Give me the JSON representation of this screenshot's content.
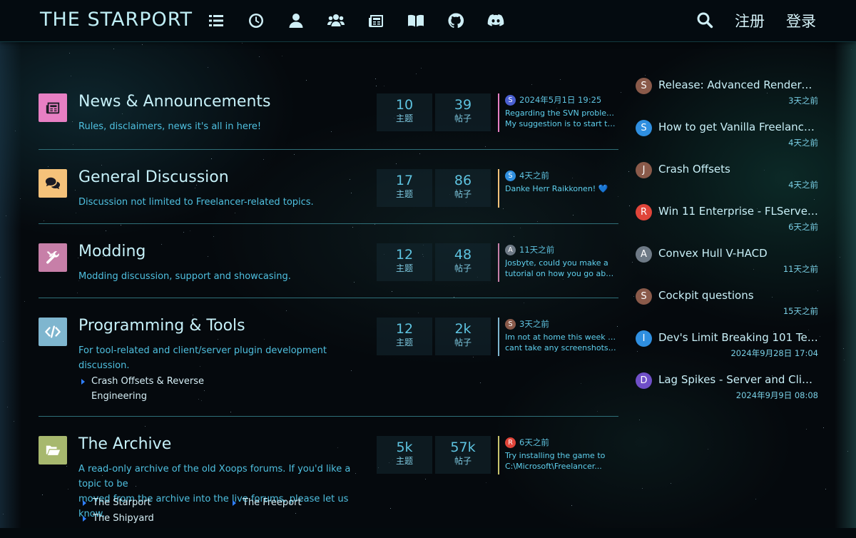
{
  "header": {
    "brand": "THE STARPORT",
    "nav_icons": [
      "list-icon",
      "clock-icon",
      "user-icon",
      "users-icon",
      "newspaper-icon",
      "book-icon",
      "github-icon",
      "discord-icon"
    ],
    "search_icon": "search-icon",
    "register_label": "注册",
    "login_label": "登录"
  },
  "forums": [
    {
      "title": "News & Announcements",
      "description": "Rules, disclaimers, news it's all in here!",
      "icon": "newspaper-icon",
      "icon_bg": "#e77fc3",
      "accent": "#e77fc3",
      "threads": "10",
      "threads_label": "主题",
      "posts": "39",
      "posts_label": "帖子",
      "last_avatar": "S",
      "last_avatar_color": "#4a5fd1",
      "last_time": "2024年5月1日 19:25",
      "last_excerpt_1": "Regarding the SVN problem:",
      "last_excerpt_2": "My suggestion is to start the..."
    },
    {
      "title": "General Discussion",
      "description": "Discussion not limited to Freelancer-related topics.",
      "icon": "comments-icon",
      "icon_bg": "#f5c27a",
      "accent": "#f5c27a",
      "threads": "17",
      "threads_label": "主题",
      "posts": "86",
      "posts_label": "帖子",
      "last_avatar": "S",
      "last_avatar_color": "#2f8fe0",
      "last_time": "4天之前",
      "last_excerpt_1": "Danke Herr Raikkonen! 💙",
      "last_excerpt_2": ""
    },
    {
      "title": "Modding",
      "description": "Modding discussion, support and showcasing.",
      "icon": "tools-icon",
      "icon_bg": "#c77fa8",
      "accent": "#c77fa8",
      "threads": "12",
      "threads_label": "主题",
      "posts": "48",
      "posts_label": "帖子",
      "last_avatar": "A",
      "last_avatar_color": "#6e7a86",
      "last_time": "11天之前",
      "last_excerpt_1": "Josbyte, could you make a",
      "last_excerpt_2": "tutorial on how you go about..."
    },
    {
      "title": "Programming & Tools",
      "description": "For tool-related and client/server plugin development discussion.",
      "icon": "code-icon",
      "icon_bg": "#7fb6cf",
      "accent": "#7fb6cf",
      "threads": "12",
      "threads_label": "主题",
      "posts": "2k",
      "posts_label": "帖子",
      "last_avatar": "S",
      "last_avatar_color": "#8a5a4a",
      "last_time": "3天之前",
      "last_excerpt_1": "Im not at home this week so I",
      "last_excerpt_2": "cant take any screenshots at...",
      "subforums": [
        "Crash Offsets & Reverse",
        "Engineering"
      ]
    },
    {
      "title": "The Archive",
      "description_1": "A read-only archive of the old Xoops forums. If you'd like a topic to be",
      "description_2": "moved from the archive into the live forums, please let us know.",
      "icon": "folder-open-icon",
      "icon_bg": "#a7b86e",
      "accent": "#c8c46e",
      "threads": "5k",
      "threads_label": "主题",
      "posts": "57k",
      "posts_label": "帖子",
      "last_avatar": "R",
      "last_avatar_color": "#e0453a",
      "last_time": "6天之前",
      "last_excerpt_1": "Try installing the game to",
      "last_excerpt_2": "C:\\Microsoft\\Freelancer...",
      "subforums": [
        "The Starport",
        "The Freeport",
        "The Shipyard"
      ]
    }
  ],
  "recent": [
    {
      "avatar": "S",
      "color": "#8a5a4a",
      "title": "Release: Advanced Renderer v...",
      "time": "3天之前"
    },
    {
      "avatar": "S",
      "color": "#2f8fe0",
      "title": "How to get Vanilla Freelancer r...",
      "time": "4天之前"
    },
    {
      "avatar": "J",
      "color": "#8a5a4a",
      "title": "Crash Offsets",
      "time": "4天之前"
    },
    {
      "avatar": "R",
      "color": "#e0453a",
      "title": "Win 11 Enterprise - FLServer h...",
      "time": "6天之前"
    },
    {
      "avatar": "A",
      "color": "#6e7a86",
      "title": "Convex Hull V-HACD",
      "time": "11天之前"
    },
    {
      "avatar": "S",
      "color": "#8a5a4a",
      "title": "Cockpit questions",
      "time": "15天之前"
    },
    {
      "avatar": "I",
      "color": "#2f8fe0",
      "title": "Dev's Limit Breaking 101 Tech...",
      "time": "2024年9月28日 17:04"
    },
    {
      "avatar": "D",
      "color": "#6f4fc7",
      "title": "Lag Spikes - Server and Client ...",
      "time": "2024年9月9日 08:08"
    }
  ]
}
